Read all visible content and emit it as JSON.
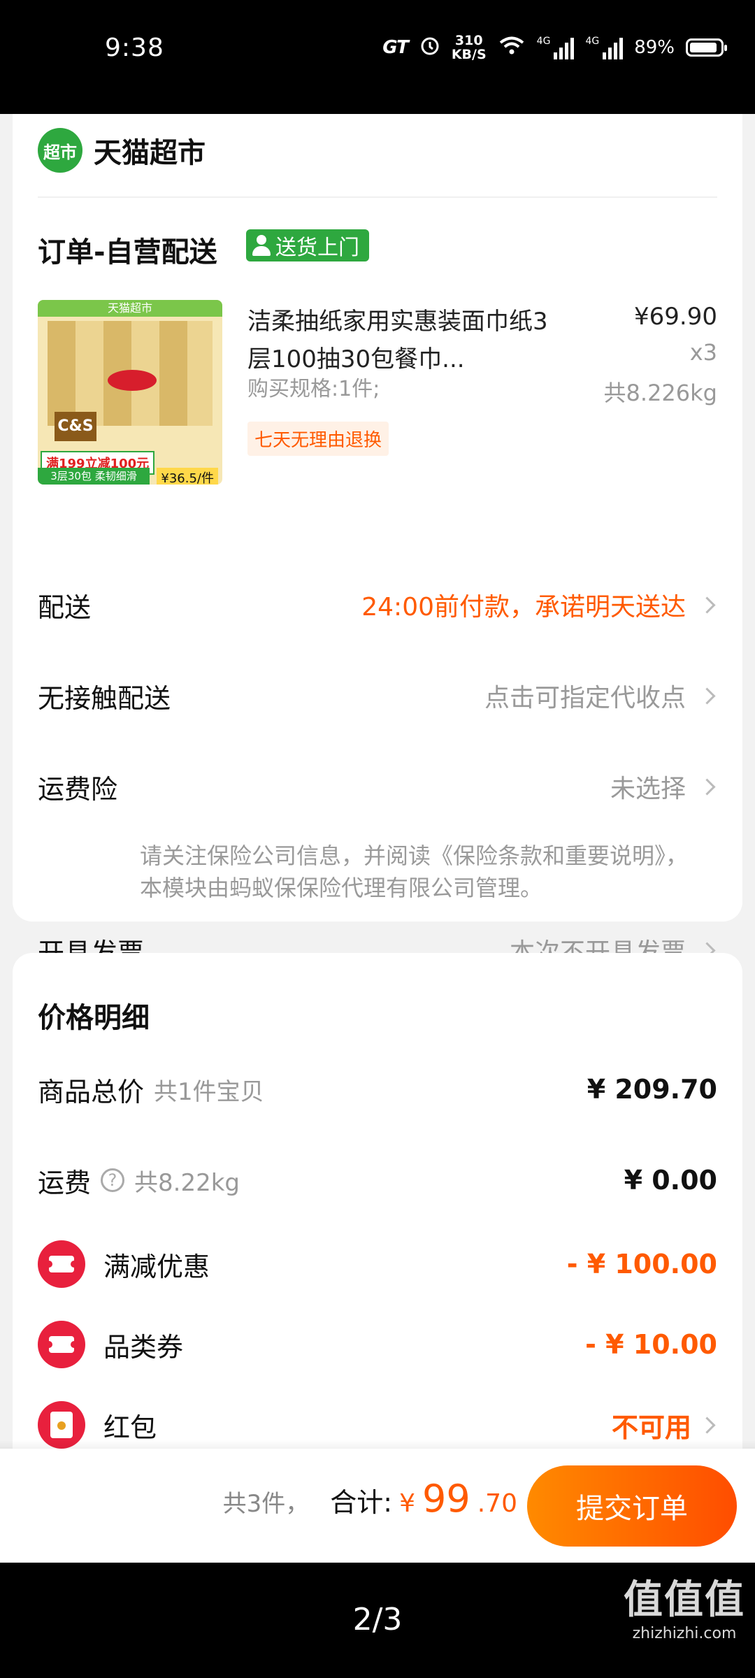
{
  "status_bar": {
    "time": "9:38",
    "gt": "GT",
    "speed_value": "310",
    "speed_unit": "KB/S",
    "net1": "4G",
    "net2": "4G",
    "battery": "89%"
  },
  "shop": {
    "logo_text": "超市",
    "name": "天猫超市"
  },
  "order": {
    "title": "订单-自营配送",
    "ship_badge": "送货上门"
  },
  "product": {
    "image_band": "天猫超市",
    "image_brand": "C&S",
    "image_promo": "满199立减100元",
    "image_unit": "¥36.5/件",
    "image_spec": "3层30包 柔韧细滑",
    "title": "洁柔抽纸家用实惠装面巾纸3层100抽30包餐巾...",
    "spec": "购买规格:1件;",
    "tag": "七天无理由退换",
    "price": "¥69.90",
    "qty": "x3",
    "weight": "共8.226kg"
  },
  "rows": {
    "delivery_label": "配送",
    "delivery_value": "24:00前付款，承诺明天送达",
    "contactless_label": "无接触配送",
    "contactless_value": "点击可指定代收点",
    "insurance_label": "运费险",
    "insurance_value": "未选择",
    "insurance_note": "请关注保险公司信息，并阅读《保险条款和重要说明》，本模块由蚂蚁保保险代理有限公司管理。",
    "invoice_label": "开具发票",
    "invoice_value": "本次不开具发票"
  },
  "price_detail": {
    "title": "价格明细",
    "goods_label": "商品总价",
    "goods_sub": "共1件宝贝",
    "goods_value": "¥ 209.70",
    "freight_label": "运费",
    "freight_sub": "共8.22kg",
    "freight_value": "¥ 0.00",
    "discount_label": "满减优惠",
    "discount_value": "- ¥ 100.00",
    "coupon_label": "品类券",
    "coupon_value": "- ¥ 10.00",
    "redpack_label": "红包",
    "redpack_value": "不可用"
  },
  "bottom": {
    "count": "共3件，",
    "total_label": "合计:",
    "currency": "¥",
    "total_int": "99",
    "total_dec": ".70",
    "submit": "提交订单"
  },
  "viewer": {
    "page": "2/3",
    "watermark_zh": "值值值",
    "watermark_en": "zhizhizhi.com"
  },
  "colors": {
    "accent": "#ff5a00",
    "green": "#2ea83f",
    "red": "#e8203d"
  }
}
